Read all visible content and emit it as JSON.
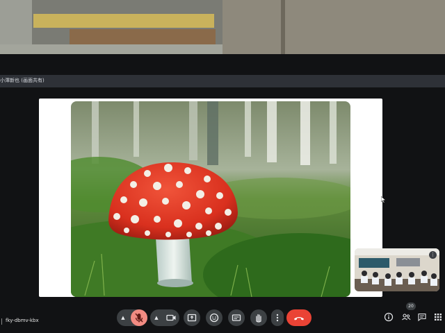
{
  "window": {
    "title": "小澤新也 (画面共有)"
  },
  "meeting": {
    "code": "fky-dbmv-kbx"
  },
  "toolbar": {
    "participants_count": "20",
    "mic_muted": true
  },
  "icons": {
    "mic": "mic-off-icon",
    "camera": "camera-icon",
    "present": "present-icon",
    "emoji": "emoji-icon",
    "captions": "captions-icon",
    "hand": "raise-hand-icon",
    "more": "more-vertical-icon",
    "end": "end-call-icon",
    "info": "info-icon",
    "people": "people-icon",
    "chat": "chat-icon",
    "activities": "grid-icon"
  },
  "colors": {
    "end_call": "#ea4335",
    "toolbar_button": "#3c4043",
    "mushroom_cap": "#d9301e"
  }
}
